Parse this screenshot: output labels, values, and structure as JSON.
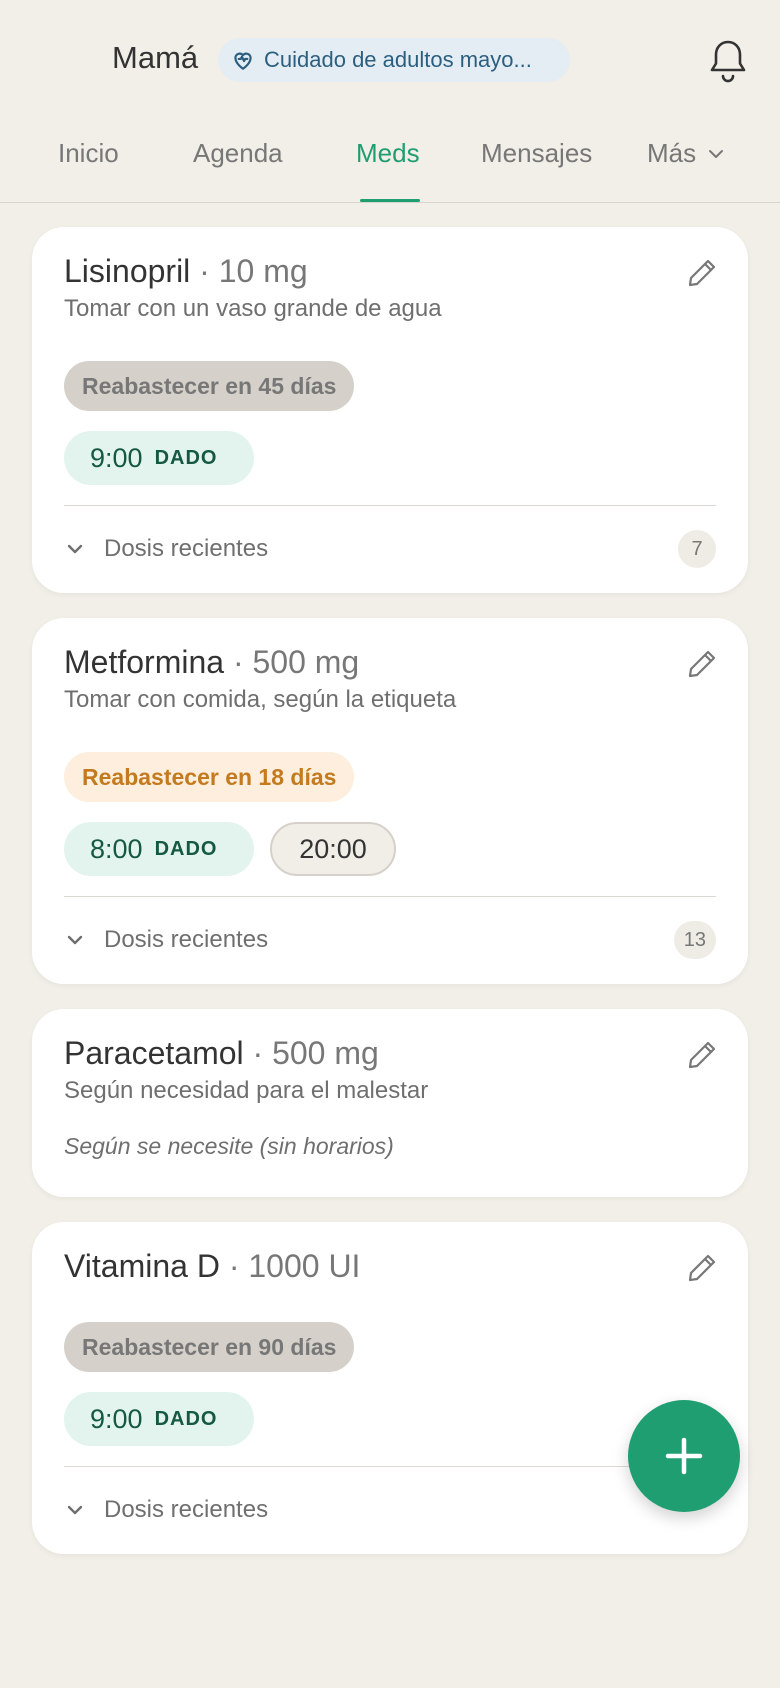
{
  "header": {
    "title": "Mamá",
    "badge_label": "Cuidado de adultos mayo..."
  },
  "tabs": [
    {
      "label": "Inicio"
    },
    {
      "label": "Agenda"
    },
    {
      "label": "Meds",
      "active": true
    },
    {
      "label": "Mensajes"
    },
    {
      "label": "Más"
    }
  ],
  "colors": {
    "accent": "#1f9e72",
    "background": "#f2efe8",
    "refill_warning": "#c47a1f",
    "badge_text": "#2b5f80"
  },
  "medications": [
    {
      "name": "Lisinopril",
      "dose": "· 10 mg",
      "instructions": "Tomar con un vaso grande de agua",
      "refill": "Reabastecer en 45 días",
      "doses": [
        {
          "time": "9:00",
          "status": "DADO"
        }
      ],
      "recent_label": "Dosis recientes",
      "recent_count": "7"
    },
    {
      "name": "Metformina",
      "dose": "· 500 mg",
      "instructions": "Tomar con comida, según la etiqueta",
      "refill": "Reabastecer en 18 días",
      "doses": [
        {
          "time": "8:00",
          "status": "DADO"
        },
        {
          "time": "20:00"
        }
      ],
      "recent_label": "Dosis recientes",
      "recent_count": "13"
    },
    {
      "name": "Paracetamol",
      "dose": "· 500 mg",
      "instructions": "Según necesidad para el malestar",
      "schedule_note": "Según se necesite (sin horarios)"
    },
    {
      "name": "Vitamina D",
      "dose": "· 1000 UI",
      "refill": "Reabastecer en 90 días",
      "doses": [
        {
          "time": "9:00",
          "status": "DADO"
        }
      ],
      "recent_label": "Dosis recientes"
    }
  ],
  "icons": {
    "badge": "heart-pulse-icon",
    "notifications": "bell-icon",
    "edit": "pencil-icon",
    "expand": "chevron-down-icon",
    "add": "plus-icon"
  }
}
